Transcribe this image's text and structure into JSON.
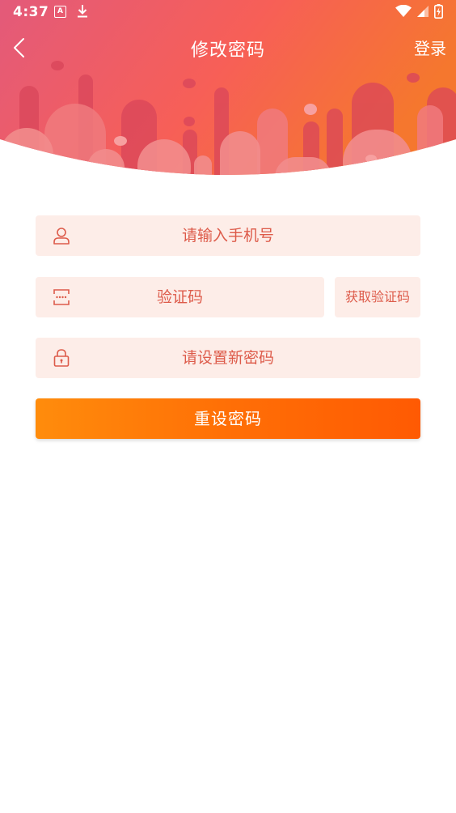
{
  "status_bar": {
    "time": "4:37",
    "notification_icon_letter": "A"
  },
  "nav": {
    "title": "修改密码",
    "login_label": "登录"
  },
  "form": {
    "phone_placeholder": "请输入手机号",
    "code_placeholder": "验证码",
    "get_code_label": "获取验证码",
    "password_placeholder": "请设置新密码",
    "submit_label": "重设密码"
  },
  "colors": {
    "header_gradient_start": "#e35a7a",
    "header_gradient_end": "#f5772e",
    "field_background": "#fdede8",
    "accent_text": "#dd5b4a",
    "button_gradient_start": "#ff8c0c",
    "button_gradient_end": "#ff5a03"
  }
}
